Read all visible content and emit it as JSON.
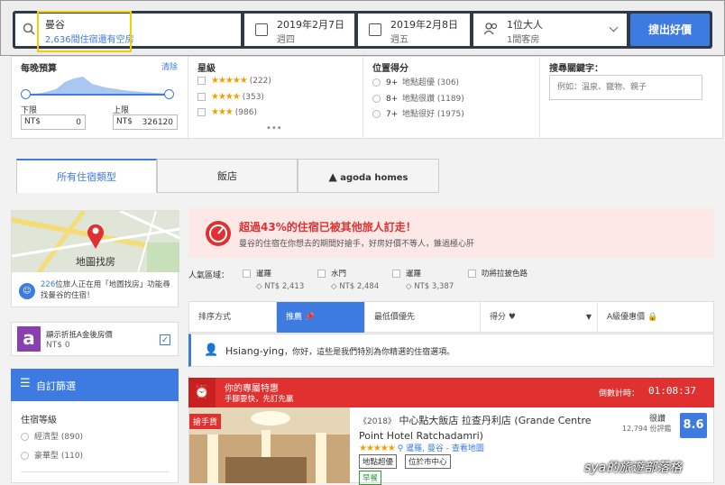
{
  "search": {
    "destination": "曼谷",
    "availability": "2,636間住宿還有空房",
    "checkin_date": "2019年2月7日",
    "checkin_day": "週四",
    "checkout_date": "2019年2月8日",
    "checkout_day": "週五",
    "guests": "1位大人",
    "rooms": "1間客房",
    "search_button": "搜出好價"
  },
  "budget": {
    "title": "每晚預算",
    "clear": "清除",
    "min_label": "下限",
    "max_label": "上限",
    "currency": "NT$",
    "min_value": "0",
    "max_value": "326120"
  },
  "stars": {
    "title": "星級",
    "items": [
      {
        "stars": "★★★★★",
        "count": "(222)"
      },
      {
        "stars": "★★★★",
        "count": "(353)"
      },
      {
        "stars": "★★★",
        "count": "(986)"
      }
    ],
    "more": "•••"
  },
  "location": {
    "title": "位置得分",
    "items": [
      {
        "score": "9+",
        "label": "地點超優 (306)"
      },
      {
        "score": "8+",
        "label": "地點很讚 (1189)"
      },
      {
        "score": "7+",
        "label": "地點很好 (1975)"
      }
    ]
  },
  "keyword": {
    "title": "搜尋關鍵字：",
    "placeholder": "例如：溫泉、寵物、親子"
  },
  "tabs": {
    "all": "所有住宿類型",
    "hotels": "飯店",
    "agoda_homes": "agoda homes"
  },
  "map": {
    "button": "地圖找房",
    "count": "226",
    "note_rest": "位旅人正在用「地圖找房」功能尋找曼谷的住宿！"
  },
  "discount": {
    "label": "顯示折抵A金後房價",
    "amount": "NT$ 0"
  },
  "custom_filter": {
    "title": "自訂篩選",
    "group": "住宿等級",
    "items": [
      "經濟型 (890)",
      "豪華型 (110)"
    ]
  },
  "alert": {
    "title": "超過43%的住宿已被其他旅人訂走！",
    "subtitle": "曼谷的住宿在你想去的期間好搶手，好房好價不等人，錐過極心肝"
  },
  "areas": {
    "label": "人氣區域：",
    "items": [
      {
        "name": "暹羅",
        "price": "NT$ 2,413"
      },
      {
        "name": "水門",
        "price": "NT$ 2,484"
      },
      {
        "name": "暹羅",
        "price": "NT$ 3,387"
      },
      {
        "name": "叻將拉披色路",
        "price": ""
      }
    ]
  },
  "sort": {
    "label": "排序方式",
    "recommended": "推薦",
    "lowest": "最低價優先",
    "rating": "得分",
    "secret": "A級優惠價"
  },
  "greeting": {
    "name": "Hsiang-ying",
    "message": "，你好，這些是我們特別為你精選的住宿選項。"
  },
  "deal": {
    "title": "你的專屬特惠",
    "subtitle": "手腳要快，先訂先贏",
    "countdown_label": "倒數計時：",
    "countdown": "01:08:37"
  },
  "hotel": {
    "badge": "搶手貨",
    "year": "2018",
    "name": "中心點大飯店 拉查丹利店 (Grande Centre Point Hotel Ratchadamri)",
    "stars": "★★★★★",
    "location": "暹羅, 曼谷 - 查看地圖",
    "tag1": "地點超優",
    "tag2": "位於市中心",
    "tag3": "早餐",
    "rating_word": "很讚",
    "reviews": "12,794 份評鑑",
    "score": "8.6"
  },
  "watermark": "sya的旅遊部落格",
  "colors": {
    "accent": "#3d7be0",
    "red": "#e03030",
    "navy": "#2f3a48"
  }
}
